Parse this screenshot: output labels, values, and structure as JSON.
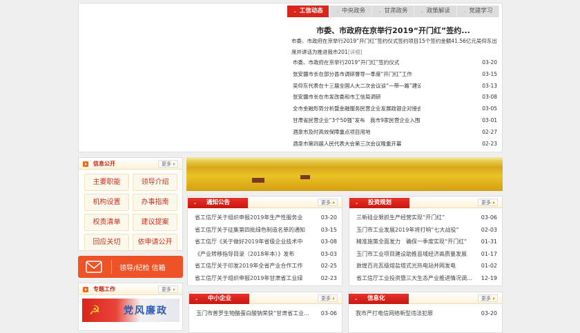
{
  "tabs": [
    "工信动态",
    "中央政务",
    "甘肃政务",
    "政策解读",
    "党建学习"
  ],
  "headline": "市委、市政府在京举行2019“开门红”签约...",
  "summary": "市委、市政府在京举行2019“开门红”签约仪式签约项目15个签约金额41.56亿元吴仰东出席并讲话为推进我市201",
  "summary_more": "[详细]",
  "news": [
    {
      "t": "市委、市政府在京举行2019“开门红”签约仪式",
      "d": "03-20"
    },
    {
      "t": "张安疆市长在部分县市调研督导一季度“开门红”工作",
      "d": "03-15"
    },
    {
      "t": "吴仰东代表在十三届全国人大二次会议谈“一带一路”建设",
      "d": "03-13"
    },
    {
      "t": "张安疆市长在市发改委和市工信局调研",
      "d": "03-08"
    },
    {
      "t": "全市金融形势分析暨金融服务民营企业发展政银企对接会",
      "d": "03-05"
    },
    {
      "t": "甘肃省民营企业“3个50强”发布　我市9家民营企业入围",
      "d": "03-01"
    },
    {
      "t": "酒泉市及时高效保障重点项目用地",
      "d": "02-27"
    },
    {
      "t": "酒泉市第四届人民代表大会第三次会议隆重开幕",
      "d": "02-23"
    }
  ],
  "more": "更多",
  "info": {
    "title": "信息公开",
    "buttons": [
      "主要职能",
      "领导介绍",
      "机构设置",
      "办事指南",
      "权责清单",
      "建议提案",
      "回应关切",
      "依申请公开"
    ]
  },
  "mail": "领导/纪检 信箱",
  "special": {
    "title": "专题工作",
    "banner": "党风廉政"
  },
  "notice": {
    "title": "通知公告",
    "items": [
      {
        "t": "省工信厅关于组织申报2019年生产性服务业",
        "d": "03-20"
      },
      {
        "t": "省工信厅关于征集第四批绿色制造名单的通知",
        "d": "03-15"
      },
      {
        "t": "省工信厅《关于做好2019年省级企业技术中",
        "d": "03-08"
      },
      {
        "t": "《产业转移指导目录（2018年本）》发布",
        "d": "03-03"
      },
      {
        "t": "省工信厅关于印发2019年全省产业合作工作",
        "d": "02-25"
      },
      {
        "t": "省工信厅关于组织申报2019年甘肃省工业绿",
        "d": "02-23"
      }
    ]
  },
  "invest": {
    "title": "投资规划",
    "items": [
      {
        "t": "三新硅业狠抓生产经营实现“开门红”",
        "d": "03-06"
      },
      {
        "t": "玉门市工业发展2019年将打响“七大战役”",
        "d": "02-03"
      },
      {
        "t": "精准施策全面发力　确保一季度实现“开门红”",
        "d": "01-31"
      },
      {
        "t": "玉门市工业项目建设助推县域经济高质量发展",
        "d": "01-17"
      },
      {
        "t": "敦煌百兆瓦级熔盐塔式光热电站并网发电",
        "d": "01-02"
      },
      {
        "t": "省工信厅工业投资暨三大生态产业推进情况调...",
        "d": "12-19"
      }
    ]
  },
  "sme": {
    "title": "中小企业",
    "items": [
      {
        "t": "玉门市普罗生物酪蛋白酸钠荣获“甘肃省工业...",
        "d": "03-06"
      }
    ]
  },
  "it": {
    "title": "信息化",
    "items": [
      {
        "t": "我市严打电信网络新型违法犯罪",
        "d": "03-20"
      }
    ]
  }
}
